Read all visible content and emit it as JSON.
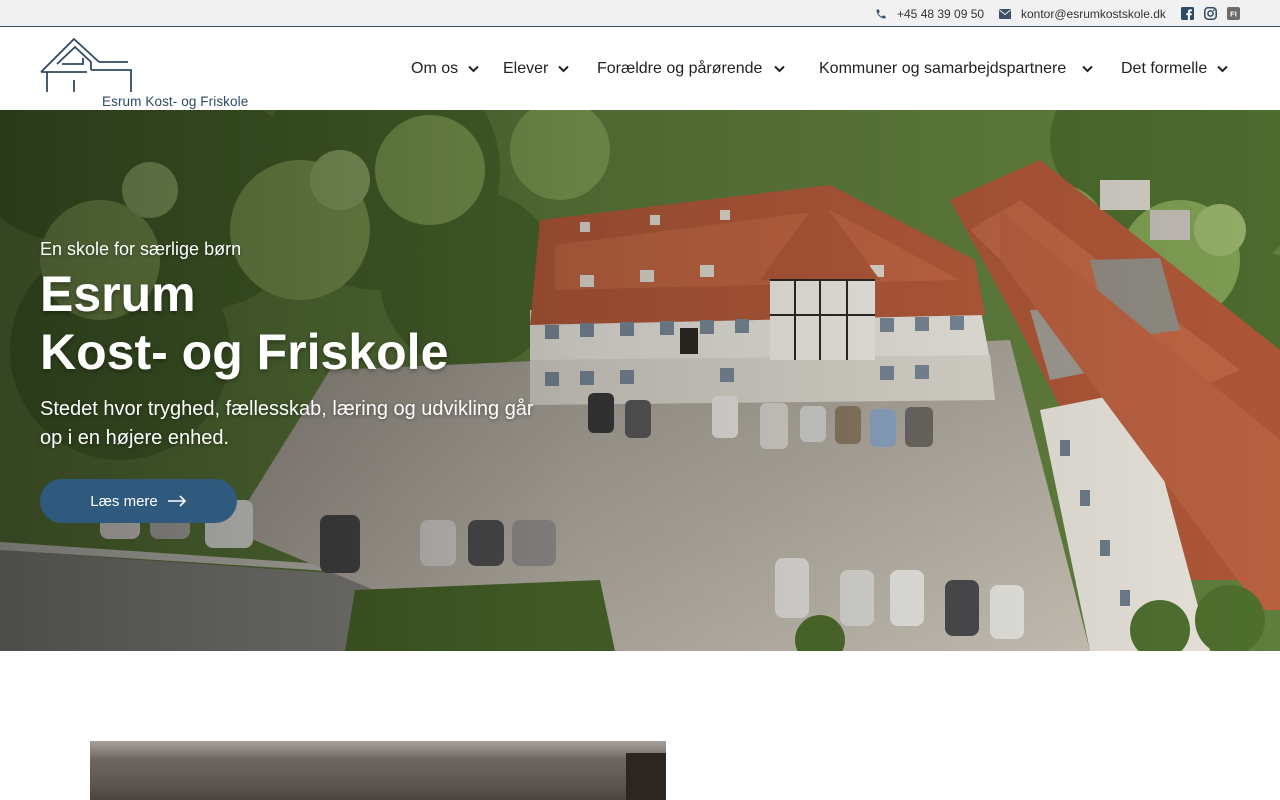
{
  "topbar": {
    "phone": "+45 48 39 09 50",
    "email": "kontor@esrumkostskole.dk",
    "icons": [
      "phone-icon",
      "envelope-icon",
      "facebook-icon",
      "instagram-icon",
      "fi-icon"
    ],
    "social_fi_label": "FI"
  },
  "header": {
    "logo_text": "Esrum Kost- og Friskole",
    "nav": [
      {
        "label": "Om os"
      },
      {
        "label": "Elever"
      },
      {
        "label": "Forældre og pårørende"
      },
      {
        "label": "Kommuner og samarbejdspartnere"
      },
      {
        "label": "Det formelle"
      }
    ]
  },
  "hero": {
    "kicker": "En skole for særlige børn",
    "title_line1": "Esrum",
    "title_line2": "Kost- og Friskole",
    "subtitle": "Stedet hvor tryghed, fællesskab, læring og udvikling går op i en højere enhed.",
    "button_label": "Læs mere"
  },
  "colors": {
    "brand": "#2f5a7e",
    "logo": "#2f4a66",
    "topbar_bg": "#f1f1f1"
  }
}
